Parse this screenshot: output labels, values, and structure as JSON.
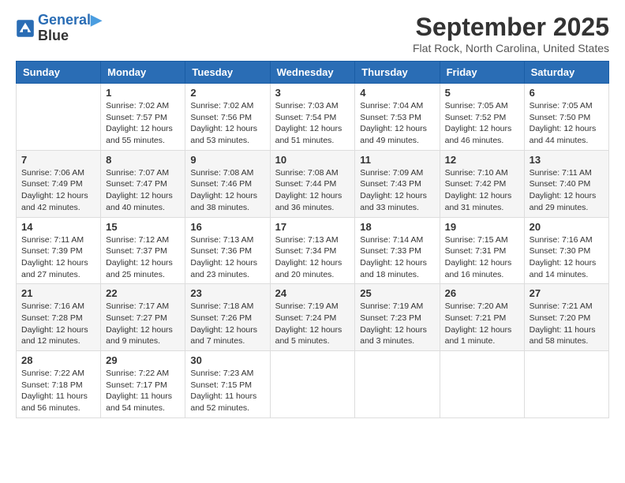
{
  "logo": {
    "line1": "General",
    "line2": "Blue"
  },
  "title": "September 2025",
  "location": "Flat Rock, North Carolina, United States",
  "weekdays": [
    "Sunday",
    "Monday",
    "Tuesday",
    "Wednesday",
    "Thursday",
    "Friday",
    "Saturday"
  ],
  "weeks": [
    [
      {
        "day": "",
        "info": ""
      },
      {
        "day": "1",
        "info": "Sunrise: 7:02 AM\nSunset: 7:57 PM\nDaylight: 12 hours\nand 55 minutes."
      },
      {
        "day": "2",
        "info": "Sunrise: 7:02 AM\nSunset: 7:56 PM\nDaylight: 12 hours\nand 53 minutes."
      },
      {
        "day": "3",
        "info": "Sunrise: 7:03 AM\nSunset: 7:54 PM\nDaylight: 12 hours\nand 51 minutes."
      },
      {
        "day": "4",
        "info": "Sunrise: 7:04 AM\nSunset: 7:53 PM\nDaylight: 12 hours\nand 49 minutes."
      },
      {
        "day": "5",
        "info": "Sunrise: 7:05 AM\nSunset: 7:52 PM\nDaylight: 12 hours\nand 46 minutes."
      },
      {
        "day": "6",
        "info": "Sunrise: 7:05 AM\nSunset: 7:50 PM\nDaylight: 12 hours\nand 44 minutes."
      }
    ],
    [
      {
        "day": "7",
        "info": "Sunrise: 7:06 AM\nSunset: 7:49 PM\nDaylight: 12 hours\nand 42 minutes."
      },
      {
        "day": "8",
        "info": "Sunrise: 7:07 AM\nSunset: 7:47 PM\nDaylight: 12 hours\nand 40 minutes."
      },
      {
        "day": "9",
        "info": "Sunrise: 7:08 AM\nSunset: 7:46 PM\nDaylight: 12 hours\nand 38 minutes."
      },
      {
        "day": "10",
        "info": "Sunrise: 7:08 AM\nSunset: 7:44 PM\nDaylight: 12 hours\nand 36 minutes."
      },
      {
        "day": "11",
        "info": "Sunrise: 7:09 AM\nSunset: 7:43 PM\nDaylight: 12 hours\nand 33 minutes."
      },
      {
        "day": "12",
        "info": "Sunrise: 7:10 AM\nSunset: 7:42 PM\nDaylight: 12 hours\nand 31 minutes."
      },
      {
        "day": "13",
        "info": "Sunrise: 7:11 AM\nSunset: 7:40 PM\nDaylight: 12 hours\nand 29 minutes."
      }
    ],
    [
      {
        "day": "14",
        "info": "Sunrise: 7:11 AM\nSunset: 7:39 PM\nDaylight: 12 hours\nand 27 minutes."
      },
      {
        "day": "15",
        "info": "Sunrise: 7:12 AM\nSunset: 7:37 PM\nDaylight: 12 hours\nand 25 minutes."
      },
      {
        "day": "16",
        "info": "Sunrise: 7:13 AM\nSunset: 7:36 PM\nDaylight: 12 hours\nand 23 minutes."
      },
      {
        "day": "17",
        "info": "Sunrise: 7:13 AM\nSunset: 7:34 PM\nDaylight: 12 hours\nand 20 minutes."
      },
      {
        "day": "18",
        "info": "Sunrise: 7:14 AM\nSunset: 7:33 PM\nDaylight: 12 hours\nand 18 minutes."
      },
      {
        "day": "19",
        "info": "Sunrise: 7:15 AM\nSunset: 7:31 PM\nDaylight: 12 hours\nand 16 minutes."
      },
      {
        "day": "20",
        "info": "Sunrise: 7:16 AM\nSunset: 7:30 PM\nDaylight: 12 hours\nand 14 minutes."
      }
    ],
    [
      {
        "day": "21",
        "info": "Sunrise: 7:16 AM\nSunset: 7:28 PM\nDaylight: 12 hours\nand 12 minutes."
      },
      {
        "day": "22",
        "info": "Sunrise: 7:17 AM\nSunset: 7:27 PM\nDaylight: 12 hours\nand 9 minutes."
      },
      {
        "day": "23",
        "info": "Sunrise: 7:18 AM\nSunset: 7:26 PM\nDaylight: 12 hours\nand 7 minutes."
      },
      {
        "day": "24",
        "info": "Sunrise: 7:19 AM\nSunset: 7:24 PM\nDaylight: 12 hours\nand 5 minutes."
      },
      {
        "day": "25",
        "info": "Sunrise: 7:19 AM\nSunset: 7:23 PM\nDaylight: 12 hours\nand 3 minutes."
      },
      {
        "day": "26",
        "info": "Sunrise: 7:20 AM\nSunset: 7:21 PM\nDaylight: 12 hours\nand 1 minute."
      },
      {
        "day": "27",
        "info": "Sunrise: 7:21 AM\nSunset: 7:20 PM\nDaylight: 11 hours\nand 58 minutes."
      }
    ],
    [
      {
        "day": "28",
        "info": "Sunrise: 7:22 AM\nSunset: 7:18 PM\nDaylight: 11 hours\nand 56 minutes."
      },
      {
        "day": "29",
        "info": "Sunrise: 7:22 AM\nSunset: 7:17 PM\nDaylight: 11 hours\nand 54 minutes."
      },
      {
        "day": "30",
        "info": "Sunrise: 7:23 AM\nSunset: 7:15 PM\nDaylight: 11 hours\nand 52 minutes."
      },
      {
        "day": "",
        "info": ""
      },
      {
        "day": "",
        "info": ""
      },
      {
        "day": "",
        "info": ""
      },
      {
        "day": "",
        "info": ""
      }
    ]
  ]
}
